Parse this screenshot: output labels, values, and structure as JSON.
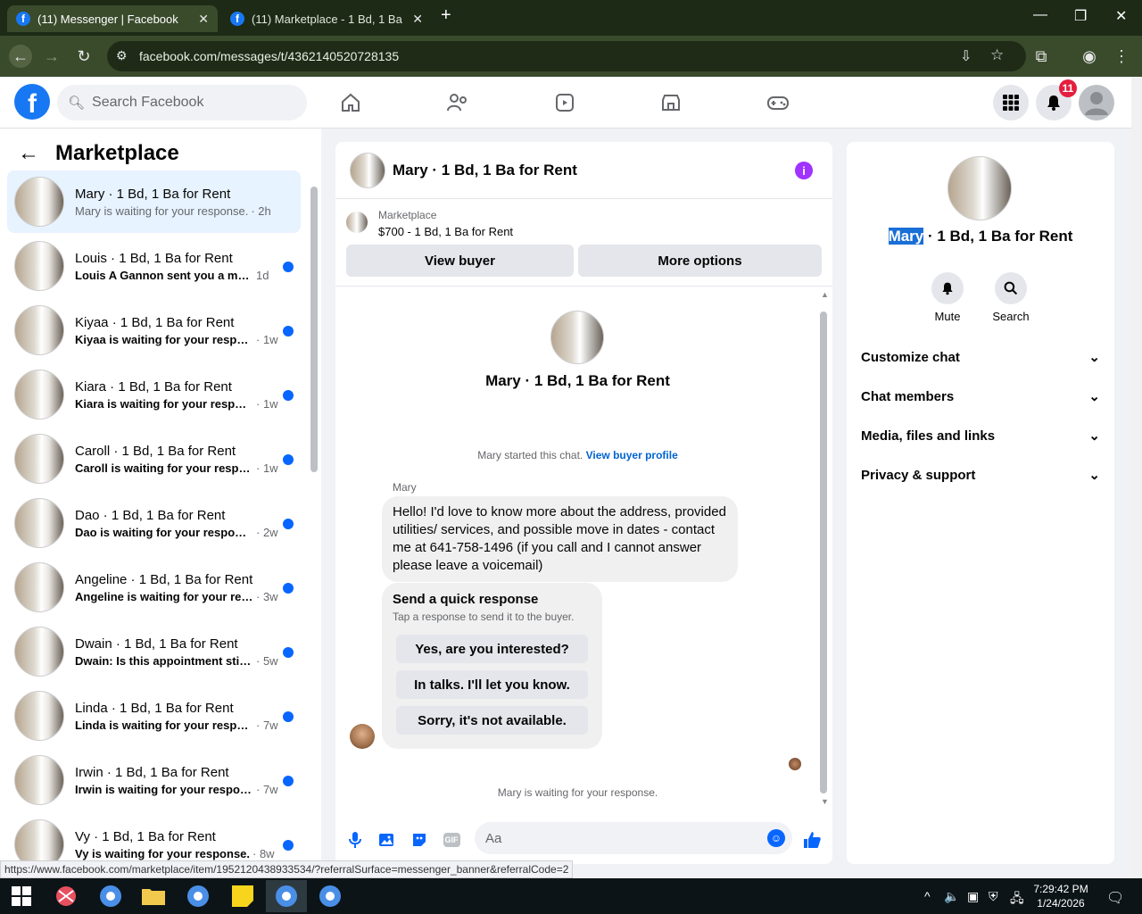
{
  "browser": {
    "tabs": [
      {
        "title": "(11) Messenger | Facebook",
        "active": true
      },
      {
        "title": "(11) Marketplace - 1 Bd, 1 Ba fo",
        "active": false
      }
    ],
    "new_tab_glyph": "+",
    "url": "facebook.com/messages/t/4362140520728135",
    "status_url": "https://www.facebook.com/marketplace/item/1952120438933534/?referralSurface=messenger_banner&referralCode=2"
  },
  "header": {
    "search_placeholder": "Search Facebook",
    "notification_count": "11"
  },
  "sidebar": {
    "title": "Marketplace",
    "conversations": [
      {
        "name": "Mary · 1 Bd, 1 Ba for Rent",
        "preview": "Mary is waiting for your response.",
        "time": "· 2h",
        "unread": false,
        "active": true
      },
      {
        "name": "Louis · 1 Bd, 1 Ba for Rent",
        "preview": "Louis A Gannon sent you a mess...",
        "time": "1d",
        "unread": true
      },
      {
        "name": "Kiyaa · 1 Bd, 1 Ba for Rent",
        "preview": "Kiyaa is waiting for your respon...",
        "time": "· 1w",
        "unread": true
      },
      {
        "name": "Kiara · 1 Bd, 1 Ba for Rent",
        "preview": "Kiara is waiting for your respon...",
        "time": "· 1w",
        "unread": true
      },
      {
        "name": "Caroll · 1 Bd, 1 Ba for Rent",
        "preview": "Caroll is waiting for your respo...",
        "time": "· 1w",
        "unread": true
      },
      {
        "name": "Dao · 1 Bd, 1 Ba for Rent",
        "preview": "Dao is waiting for your response.",
        "time": "· 2w",
        "unread": true
      },
      {
        "name": "Angeline · 1 Bd, 1 Ba for Rent",
        "preview": "Angeline is waiting for your res...",
        "time": "· 3w",
        "unread": true
      },
      {
        "name": "Dwain · 1 Bd, 1 Ba for Rent",
        "preview": "Dwain: Is this appointment still ...",
        "time": "· 5w",
        "unread": true
      },
      {
        "name": "Linda · 1 Bd, 1 Ba for Rent",
        "preview": "Linda is waiting for your respon...",
        "time": "· 7w",
        "unread": true
      },
      {
        "name": "Irwin · 1 Bd, 1 Ba for Rent",
        "preview": "Irwin is waiting for your respon...",
        "time": "· 7w",
        "unread": true
      },
      {
        "name": "Vy · 1 Bd, 1 Ba for Rent",
        "preview": "Vy is waiting for your response.",
        "time": "· 8w",
        "unread": true
      }
    ]
  },
  "chat": {
    "title": "Mary · 1 Bd, 1 Ba for Rent",
    "marketplace_label": "Marketplace",
    "listing": "$700 - 1 Bd, 1 Ba for Rent",
    "view_buyer": "View buyer",
    "more_options": "More options",
    "convo_name": "Mary · 1 Bd, 1 Ba for Rent",
    "started_text": "Mary started this chat.",
    "view_buyer_profile": "View buyer profile",
    "sender": "Mary",
    "message": "Hello! I'd love to know more about the address, provided utilities/ services, and possible move in dates - contact me at 641-758-1496 (if you call and I cannot answer please leave a voicemail)",
    "quick_title": "Send a quick response",
    "quick_sub": "Tap a response to send it to the buyer.",
    "quick_responses": [
      "Yes, are you interested?",
      "In talks. I'll let you know.",
      "Sorry, it's not available."
    ],
    "waiting": "Mary is waiting for your response.",
    "input_placeholder": "Aa",
    "gif_label": "GIF"
  },
  "details": {
    "name_highlight": "Mary",
    "name_rest": " · 1 Bd, 1 Ba for Rent",
    "mute": "Mute",
    "search": "Search",
    "sections": [
      "Customize chat",
      "Chat members",
      "Media, files and links",
      "Privacy & support"
    ]
  },
  "taskbar": {
    "time": "7:29:42 PM",
    "date": "1/24/2026"
  },
  "colors": {
    "accent": "#0866ff",
    "facebook_blue": "#1877f2",
    "info": "#a033ff",
    "badge": "#e41e3f"
  }
}
